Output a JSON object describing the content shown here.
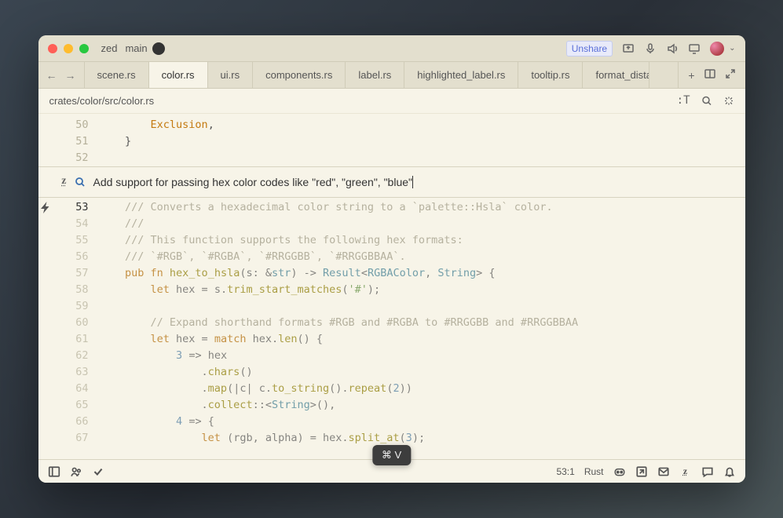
{
  "titlebar": {
    "app_name": "zed",
    "branch": "main",
    "unshare_label": "Unshare"
  },
  "nav": {
    "back": "←",
    "fwd": "→"
  },
  "tabs": [
    {
      "label": "scene.rs",
      "active": false
    },
    {
      "label": "color.rs",
      "active": true
    },
    {
      "label": "ui.rs",
      "active": false
    },
    {
      "label": "components.rs",
      "active": false
    },
    {
      "label": "label.rs",
      "active": false
    },
    {
      "label": "highlighted_label.rs",
      "active": false
    },
    {
      "label": "tooltip.rs",
      "active": false
    },
    {
      "label": "format_dista",
      "active": false
    }
  ],
  "breadcrumb": "crates/color/src/color.rs",
  "crumb_actions": {
    "tt": ":T"
  },
  "top_lines": [
    {
      "n": 50,
      "tokens": [
        [
          "        ",
          ""
        ],
        [
          "Exclusion",
          "c-orange"
        ],
        [
          ",",
          "c-punc"
        ]
      ]
    },
    {
      "n": 51,
      "tokens": [
        [
          "    }",
          "c-punc"
        ]
      ]
    },
    {
      "n": 52,
      "tokens": [
        [
          "",
          ""
        ]
      ]
    }
  ],
  "prompt": {
    "value": "Add support for passing hex color codes like \"red\", \"green\", \"blue\""
  },
  "bottom_lines": [
    {
      "n": 53,
      "bolt": true,
      "tokens": [
        [
          "    ",
          ""
        ],
        [
          "/// Converts a hexadecimal color string to a `palette::Hsla` color.",
          "c-comment"
        ]
      ]
    },
    {
      "n": 54,
      "tokens": [
        [
          "    ",
          ""
        ],
        [
          "///",
          "c-comment"
        ]
      ]
    },
    {
      "n": 55,
      "tokens": [
        [
          "    ",
          ""
        ],
        [
          "/// This function supports the following hex formats:",
          "c-comment"
        ]
      ]
    },
    {
      "n": 56,
      "tokens": [
        [
          "    ",
          ""
        ],
        [
          "/// `#RGB`, `#RGBA`, `#RRGGBB`, `#RRGGBBAA`.",
          "c-comment"
        ]
      ]
    },
    {
      "n": 57,
      "tokens": [
        [
          "    ",
          ""
        ],
        [
          "pub ",
          "c-kw"
        ],
        [
          "fn ",
          "c-kw"
        ],
        [
          "hex_to_hsla",
          "c-fn"
        ],
        [
          "(",
          "c-punc"
        ],
        [
          "s",
          "c-ident"
        ],
        [
          ": &",
          "c-punc"
        ],
        [
          "str",
          "c-type"
        ],
        [
          ") -> ",
          "c-punc"
        ],
        [
          "Result",
          "c-type"
        ],
        [
          "<",
          "c-punc"
        ],
        [
          "RGBAColor",
          "c-type"
        ],
        [
          ", ",
          "c-punc"
        ],
        [
          "String",
          "c-type"
        ],
        [
          "> {",
          "c-punc"
        ]
      ]
    },
    {
      "n": 58,
      "tokens": [
        [
          "        ",
          ""
        ],
        [
          "let ",
          "c-kw"
        ],
        [
          "hex = s.",
          "c-ident"
        ],
        [
          "trim_start_matches",
          "c-fn"
        ],
        [
          "(",
          "c-punc"
        ],
        [
          "'#'",
          "c-str"
        ],
        [
          ");",
          "c-punc"
        ]
      ]
    },
    {
      "n": 59,
      "tokens": [
        [
          "",
          ""
        ]
      ]
    },
    {
      "n": 60,
      "tokens": [
        [
          "        ",
          ""
        ],
        [
          "// Expand shorthand formats #RGB and #RGBA to #RRGGBB and #RRGGBBAA",
          "c-comment"
        ]
      ]
    },
    {
      "n": 61,
      "tokens": [
        [
          "        ",
          ""
        ],
        [
          "let ",
          "c-kw"
        ],
        [
          "hex = ",
          "c-ident"
        ],
        [
          "match ",
          "c-kw"
        ],
        [
          "hex.",
          "c-ident"
        ],
        [
          "len",
          "c-fn"
        ],
        [
          "() {",
          "c-punc"
        ]
      ]
    },
    {
      "n": 62,
      "tokens": [
        [
          "            ",
          ""
        ],
        [
          "3",
          "c-num"
        ],
        [
          " => hex",
          "c-ident"
        ]
      ]
    },
    {
      "n": 63,
      "tokens": [
        [
          "                .",
          ""
        ],
        [
          "chars",
          "c-fn"
        ],
        [
          "()",
          "c-punc"
        ]
      ]
    },
    {
      "n": 64,
      "tokens": [
        [
          "                .",
          ""
        ],
        [
          "map",
          "c-fn"
        ],
        [
          "(|",
          "c-punc"
        ],
        [
          "c",
          "c-ident"
        ],
        [
          "| c.",
          "c-ident"
        ],
        [
          "to_string",
          "c-fn"
        ],
        [
          "().",
          "c-punc"
        ],
        [
          "repeat",
          "c-fn"
        ],
        [
          "(",
          "c-punc"
        ],
        [
          "2",
          "c-num"
        ],
        [
          "))",
          "c-punc"
        ]
      ]
    },
    {
      "n": 65,
      "tokens": [
        [
          "                .",
          ""
        ],
        [
          "collect",
          "c-fn"
        ],
        [
          "::<",
          "c-punc"
        ],
        [
          "String",
          "c-type"
        ],
        [
          ">(),",
          "c-punc"
        ]
      ]
    },
    {
      "n": 66,
      "tokens": [
        [
          "            ",
          ""
        ],
        [
          "4",
          "c-num"
        ],
        [
          " => {",
          "c-punc"
        ]
      ]
    },
    {
      "n": 67,
      "tokens": [
        [
          "                ",
          ""
        ],
        [
          "let ",
          "c-kw"
        ],
        [
          "(rgb, alpha) = hex.",
          "c-ident"
        ],
        [
          "split_at",
          "c-fn"
        ],
        [
          "(",
          "c-punc"
        ],
        [
          "3",
          "c-num"
        ],
        [
          ");",
          "c-punc"
        ]
      ]
    }
  ],
  "status": {
    "cursor": "53:1",
    "lang": "Rust"
  },
  "cmd_pill": "⌘ V"
}
